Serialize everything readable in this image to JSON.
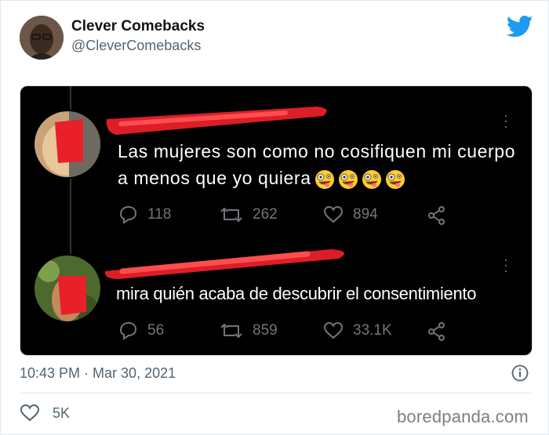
{
  "author": {
    "display_name": "Clever Comebacks",
    "handle": "@CleverComebacks",
    "avatar_icon": "user-avatar"
  },
  "brand": {
    "icon": "twitter-bird-icon",
    "color": "#1d9bf0"
  },
  "embedded_screenshot": {
    "tweet_1": {
      "text": "Las mujeres son como no cosifiquen mi cuerpo a menos que yo quiera",
      "emoji": [
        "zany-face",
        "zany-face",
        "zany-face",
        "zany-face"
      ],
      "replies": "118",
      "retweets": "262",
      "likes": "894"
    },
    "tweet_2": {
      "text": "mira quién acaba de descubrir el consentimiento",
      "replies": "56",
      "retweets": "859",
      "likes": "33.1K"
    },
    "redaction_color": "#e8202a"
  },
  "footer": {
    "timestamp": "10:43 PM · Mar 30, 2021",
    "like_count": "5K"
  },
  "watermark": "boredpanda.com"
}
